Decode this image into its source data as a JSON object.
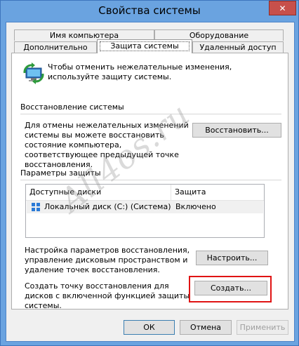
{
  "window": {
    "title": "Свойства системы",
    "close_glyph": "✕"
  },
  "tabs": {
    "row1": [
      "Имя компьютера",
      "Оборудование"
    ],
    "row2": [
      "Дополнительно",
      "Защита системы",
      "Удаленный доступ"
    ],
    "active": "Защита системы"
  },
  "info": {
    "text": "Чтобы отменить нежелательные изменения, используйте защиту системы."
  },
  "restore": {
    "section": "Восстановление системы",
    "description": "Для отмены нежелательных изменений системы вы можете восстановить состояние компьютера, соответствующее предыдущей точке восстановления.",
    "button": "Восстановить..."
  },
  "protection": {
    "section": "Параметры защиты",
    "columns": [
      "Доступные диски",
      "Защита"
    ],
    "rows": [
      {
        "drive": "Локальный диск (C:) (Система)",
        "status": "Включено"
      }
    ],
    "configure_text": "Настройка параметров восстановления, управление дисковым пространством и удаление точек восстановления.",
    "configure_button": "Настроить...",
    "create_text": "Создать точку восстановления для дисков с включенной функцией защиты системы.",
    "create_button": "Создать..."
  },
  "footer": {
    "ok": "ОК",
    "cancel": "Отмена",
    "apply": "Применить"
  },
  "watermark": "All4os.ru",
  "colors": {
    "frame": "#6aa3e0",
    "close": "#c7504b",
    "highlight": "#e01313"
  }
}
